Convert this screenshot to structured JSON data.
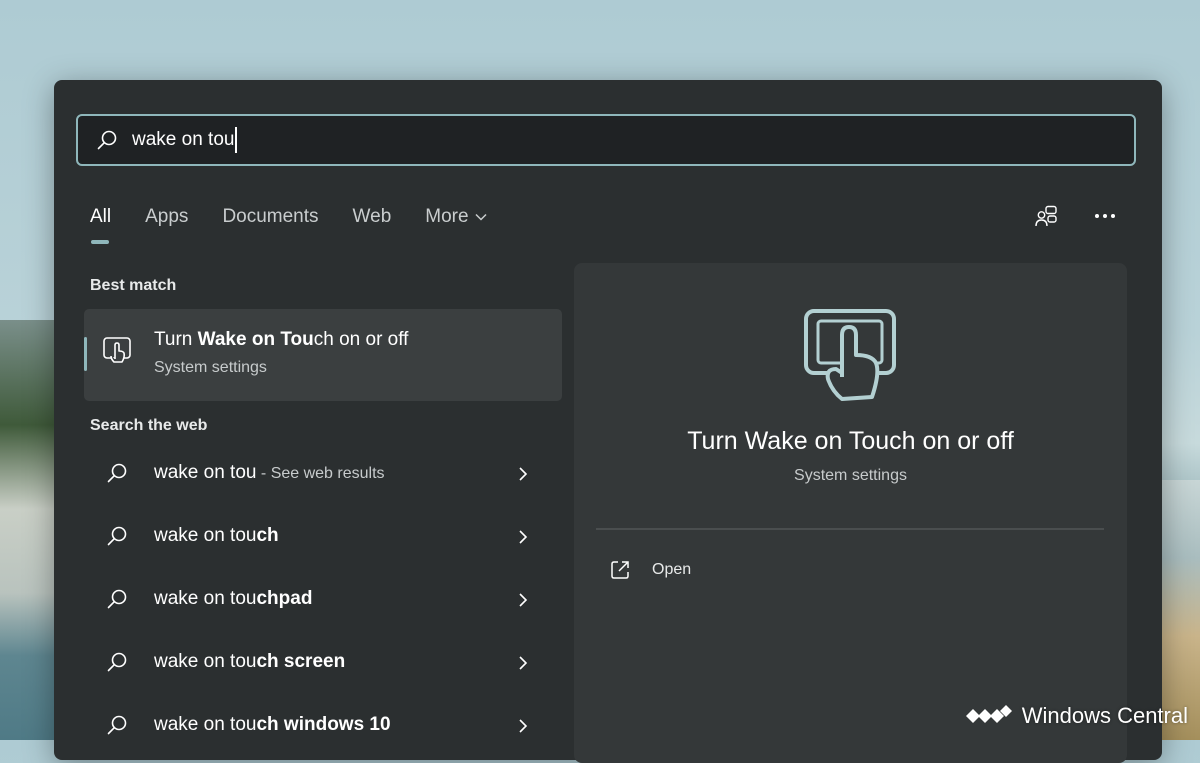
{
  "search": {
    "value": "wake on tou"
  },
  "tabs": [
    {
      "label": "All"
    },
    {
      "label": "Apps"
    },
    {
      "label": "Documents"
    },
    {
      "label": "Web"
    },
    {
      "label": "More"
    }
  ],
  "sections": {
    "best_match": "Best match",
    "search_web": "Search the web"
  },
  "best_match": {
    "title_prefix": "Turn ",
    "title_bold": "Wake on Tou",
    "title_suffix": "ch on or off",
    "subtitle": "System settings",
    "icon": "touch-hand-icon"
  },
  "web_results": [
    {
      "prefix": "wake on tou",
      "bold": "",
      "note": " - See web results"
    },
    {
      "prefix": "wake on tou",
      "bold": "ch",
      "note": ""
    },
    {
      "prefix": "wake on tou",
      "bold": "chpad",
      "note": ""
    },
    {
      "prefix": "wake on tou",
      "bold": "ch screen",
      "note": ""
    },
    {
      "prefix": "wake on tou",
      "bold": "ch windows 10",
      "note": ""
    }
  ],
  "preview": {
    "title": "Turn Wake on Touch on or off",
    "subtitle": "System settings",
    "action_label": "Open"
  },
  "watermark": {
    "text": "Windows Central"
  },
  "colors": {
    "accent": "#8fb7bb",
    "panel": "#2b2f30",
    "preview_bg": "#343839"
  }
}
